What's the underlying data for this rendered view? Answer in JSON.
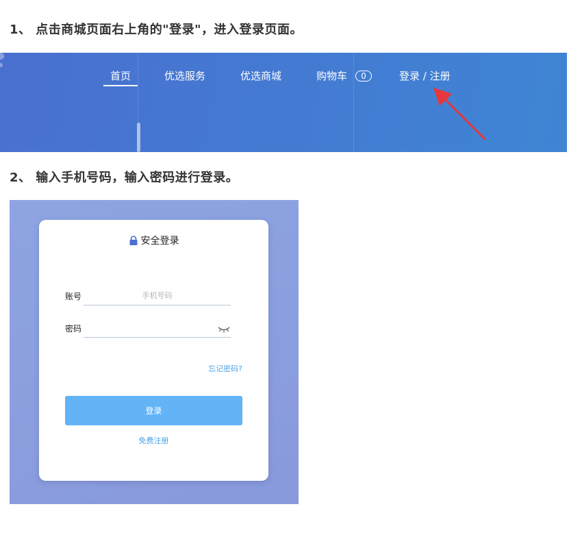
{
  "steps": {
    "step1": "1、 点击商城页面右上角的\"登录\"，进入登录页面。",
    "step2": "2、 输入手机号码，输入密码进行登录。"
  },
  "nav": {
    "home": "首页",
    "services": "优选服务",
    "mall": "优选商城",
    "cart": "购物车",
    "cart_count": "0",
    "login_register": "登录 / 注册"
  },
  "login": {
    "title": "安全登录",
    "account_label": "账号",
    "account_placeholder": "手机号码",
    "password_label": "密码",
    "forgot": "忘记密码?",
    "submit": "登录",
    "register": "免费注册"
  },
  "icons": {
    "lock": "lock-icon",
    "eye": "eye-closed-icon",
    "arrow": "red-arrow-icon"
  },
  "colors": {
    "banner": "#4479d2",
    "accent_arrow": "#e8373a",
    "login_bg": "#8b9fdf",
    "button": "#62b4f7",
    "link": "#4aa3e6",
    "lock": "#4a6fd1"
  }
}
